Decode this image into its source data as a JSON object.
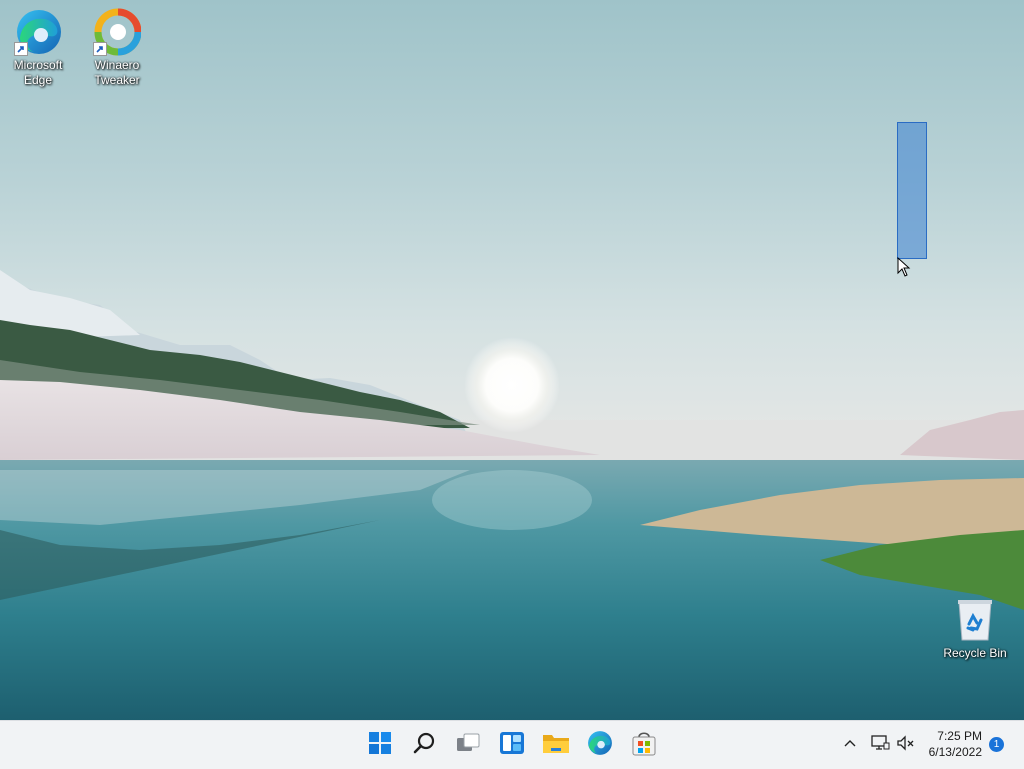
{
  "desktop": {
    "icons": [
      {
        "label": "Microsoft\nEdge",
        "icon": "edge-icon"
      },
      {
        "label": "Winaero\nTweaker",
        "icon": "winaero-tweaker-icon"
      },
      {
        "label": "Recycle Bin",
        "icon": "recycle-bin-icon"
      }
    ]
  },
  "taskbar": {
    "apps": [
      {
        "name": "Start",
        "icon": "windows-start-icon"
      },
      {
        "name": "Search",
        "icon": "search-icon"
      },
      {
        "name": "Task View",
        "icon": "task-view-icon"
      },
      {
        "name": "Widgets",
        "icon": "widgets-icon"
      },
      {
        "name": "File Explorer",
        "icon": "file-explorer-icon"
      },
      {
        "name": "Microsoft Edge",
        "icon": "edge-icon"
      },
      {
        "name": "Microsoft Store",
        "icon": "store-icon"
      }
    ],
    "tray": {
      "time": "7:25 PM",
      "date": "6/13/2022",
      "notification_count": "1"
    }
  },
  "colors": {
    "accent": "#1a73d9",
    "taskbar": "#f1f3f5"
  }
}
